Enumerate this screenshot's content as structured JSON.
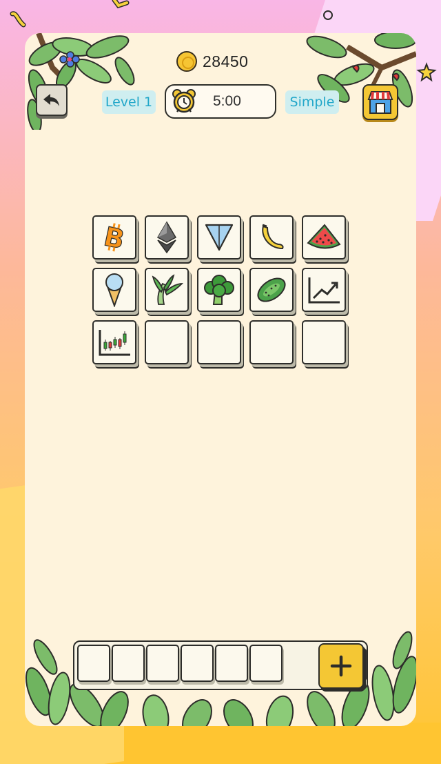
{
  "header": {
    "coins": "28450",
    "level_label": "Level 1",
    "timer": "5:00",
    "mode_label": "Simple"
  },
  "board": {
    "rows": [
      [
        "bitcoin",
        "ethereum",
        "triangle-token",
        "banana",
        "watermelon"
      ],
      [
        "ice-cream",
        "scallion",
        "broccoli",
        "cucumber",
        "growth-chart"
      ],
      [
        "candlestick-chart",
        "empty",
        "empty",
        "empty",
        "empty"
      ]
    ]
  },
  "tray": {
    "slots_filled": 0,
    "slot_count": 6
  },
  "colors": {
    "accent": "#f4c734",
    "panel": "#fef3dc",
    "badge_text": "#22a7c9",
    "badge_bg": "#cfeef0"
  }
}
